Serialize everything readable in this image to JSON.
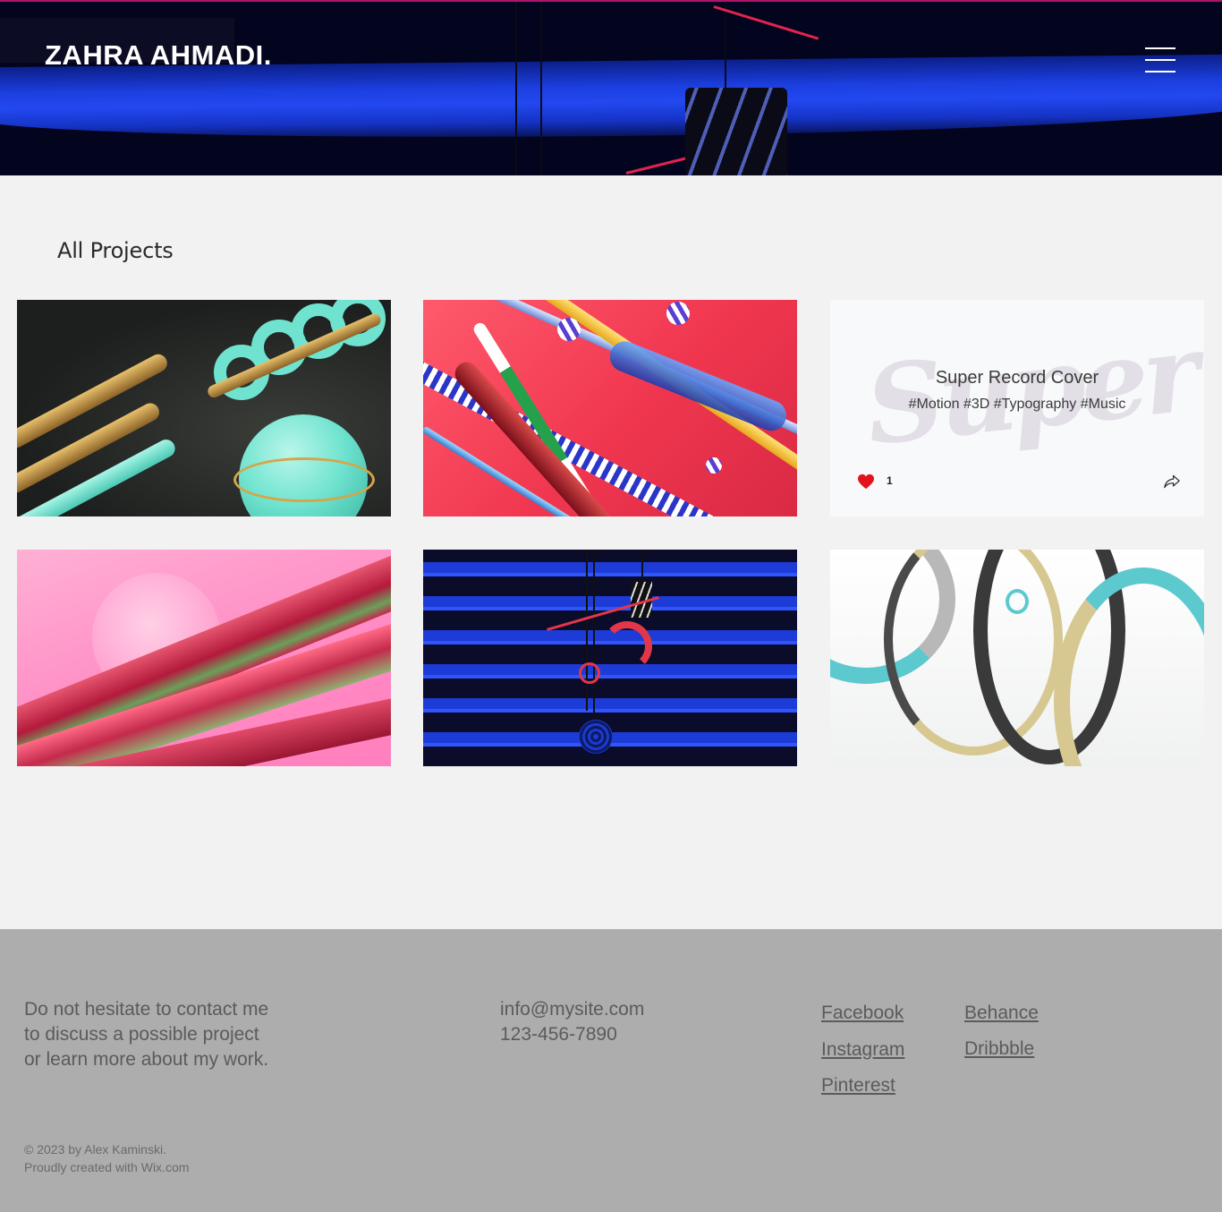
{
  "header": {
    "brand": "ZAHRA AHMADI.",
    "menu_icon": "hamburger-menu-icon"
  },
  "projects": {
    "title": "All Projects",
    "tiles": [
      {
        "id": "teal-gold-3d"
      },
      {
        "id": "red-tubes-3d"
      },
      {
        "id": "super-record-cover",
        "card_title": "Super Record Cover",
        "card_tags": "#Motion #3D #Typography #Music",
        "like_count": "1",
        "like_icon": "heart-icon",
        "share_icon": "share-icon"
      },
      {
        "id": "pink-swirl-3d"
      },
      {
        "id": "blue-stripes-3d"
      },
      {
        "id": "springs-3d"
      }
    ]
  },
  "footer": {
    "blurb": "Do not hesitate to contact me to discuss a possible project or learn more about my work.",
    "email": "info@mysite.com",
    "phone": "123-456-7890",
    "social": {
      "facebook": "Facebook",
      "instagram": "Instagram",
      "pinterest": "Pinterest",
      "behance": "Behance",
      "dribbble": "Dribbble"
    },
    "copyright_line1": "© 2023 by Alex Kaminski.",
    "copyright_line2": "Proudly created with Wix.com"
  },
  "colors": {
    "header_bg": "#03041d",
    "header_band": "#1c3fe0",
    "page_bg": "#f2f2f2",
    "footer_bg": "#adadad",
    "footer_text": "#5b5b5b"
  }
}
